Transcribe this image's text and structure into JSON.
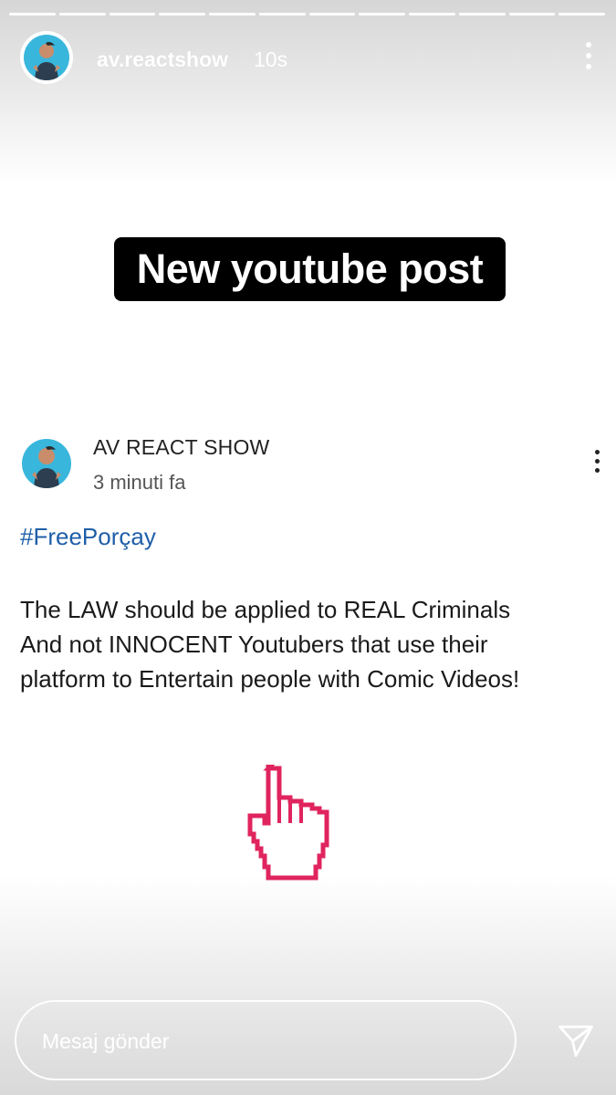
{
  "story": {
    "segments": 12,
    "username": "av.reactshow",
    "time": "10s",
    "sticker_text": "New youtube post"
  },
  "post": {
    "channel": "AV REACT SHOW",
    "ago": "3 minuti fa",
    "hashtag": "#FreePorçay",
    "lines": [
      "The LAW should be applied to REAL Criminals",
      "And not INNOCENT Youtubers that use their",
      "platform to Entertain people with Comic Videos!"
    ]
  },
  "reply": {
    "placeholder": "Mesaj gönder"
  },
  "colors": {
    "hashtag": "#1f5fa8",
    "cursor": "#e0245e",
    "avatar_bg": "#39b6dc"
  },
  "icons": [
    "more-vert-icon",
    "hand-cursor-icon",
    "send-icon"
  ]
}
